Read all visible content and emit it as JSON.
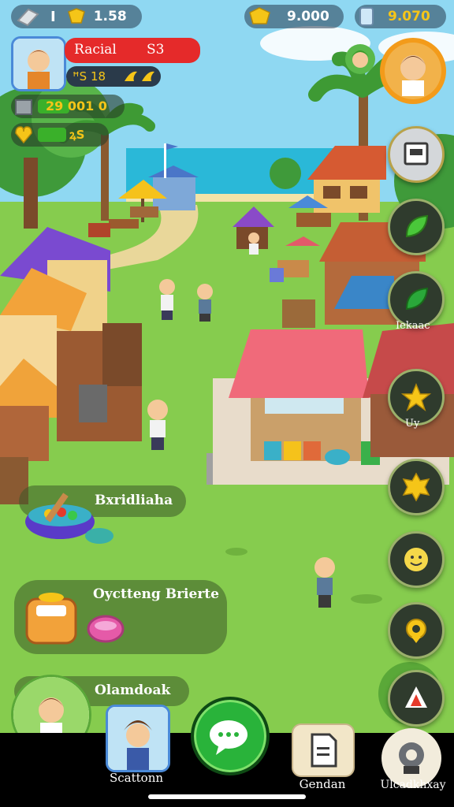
{
  "hud": {
    "stat1": {
      "icon": "stone-icon",
      "separator": "I",
      "value": "1.58"
    },
    "stat2": {
      "icon": "gold-icon",
      "value": "9.000"
    },
    "stat3": {
      "icon": "crystal-icon",
      "value": "9.070"
    }
  },
  "player": {
    "name": "Racial",
    "level": "S3",
    "substats": "ꟸS 18"
  },
  "resources": {
    "r1": {
      "icon": "crate-icon",
      "value": "29 001 0"
    },
    "r2": {
      "icon": "heart-gold-icon",
      "value": "ꝝS"
    }
  },
  "side_buttons": {
    "leaf_label": "Iekaac",
    "star_label": "Uy"
  },
  "cards": {
    "craft": {
      "label": "Bxridliaha"
    },
    "cycle": {
      "label": "Oyctteng Brierte"
    },
    "char": {
      "label": "Olamdoak"
    }
  },
  "nav": {
    "profile_label": "Scattonn",
    "shop_label": "Gendan",
    "settings_label": "Ulcadkhxay"
  },
  "colors": {
    "name_bar": "#e52a2a",
    "chat_button": "#29b33a",
    "profile_ring": "#f39b1a",
    "nav_bar": "#000000"
  }
}
